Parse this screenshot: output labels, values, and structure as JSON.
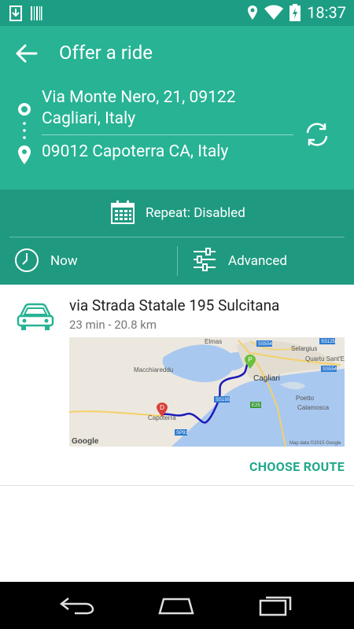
{
  "status_bar": {
    "time": "18:37",
    "icons": [
      "download-icon",
      "barcode-icon",
      "location-icon",
      "wifi-icon",
      "battery-charging-icon"
    ]
  },
  "header": {
    "title": "Offer a ride",
    "origin": "Via Monte Nero, 21, 09122 Cagliari, Italy",
    "destination": "09012 Capoterra CA, Italy"
  },
  "options": {
    "repeat": "Repeat: Disabled",
    "time": "Now",
    "advanced": "Advanced"
  },
  "route": {
    "name": "via Strada Statale 195 Sulcitana",
    "meta": "23 min - 20.8 km",
    "choose_label": "CHOOSE ROUTE",
    "map": {
      "labels": [
        "Elmas",
        "Selargius",
        "Quartu Sant'Elena",
        "Macchiareddu",
        "Cagliari",
        "Poetto",
        "Calamosca",
        "Capoterra"
      ],
      "road_labels": [
        "SS554",
        "SS125",
        "SS554",
        "SS195",
        "E25",
        "SP91"
      ],
      "start_marker": "P",
      "end_marker": "D",
      "credit": "Map data ©2015 Google",
      "logo": "Google"
    }
  },
  "colors": {
    "primary": "#27b394",
    "primary_dark": "#1f9a80",
    "status_bar": "#1d9e84",
    "accent": "#1fa88b",
    "route_line": "#1b1bb8"
  }
}
